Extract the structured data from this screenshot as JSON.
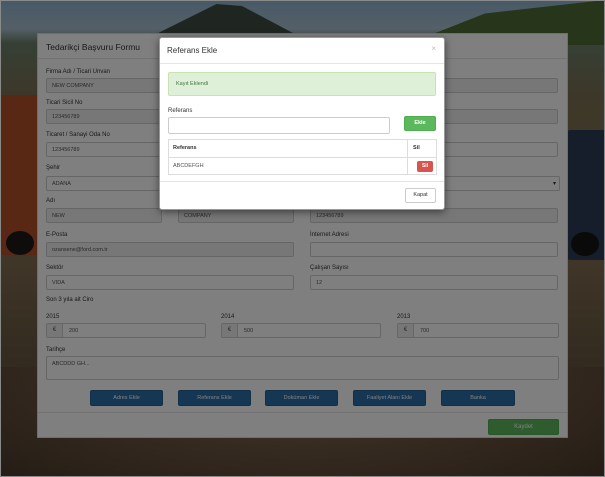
{
  "form": {
    "title": "Tedarikçi Başvuru Formu",
    "firma_adi_label": "Firma Adı / Ticari Unvan",
    "firma_adi_value": "NEW COMPANY",
    "ticari_sicil_label": "Ticari Sicil No",
    "ticari_sicil_value": "123456789",
    "ticaret_odasi_label": "Ticaret / Sanayi Oda No",
    "ticaret_odasi_value": "123456789",
    "sehir_label": "Şehir",
    "sehir_value": "ADANA",
    "adi_label": "Adı",
    "adi_value": "NEW",
    "soyadi_value": "COMPANY",
    "telefon_value": "123456789",
    "eposta_label": "E-Posta",
    "eposta_value": "ozansene@ford.com.tr",
    "internet_label": "İnternet Adresi",
    "internet_value": "",
    "sektor_label": "Sektör",
    "sektor_value": "VIDA",
    "calisan_label": "Çalışan Sayısı",
    "calisan_value": "12",
    "ciro_label": "Son 3 yıla ait Ciro",
    "currency_symbol": "€",
    "ciro": [
      {
        "year": "2015",
        "value": "200"
      },
      {
        "year": "2014",
        "value": "500"
      },
      {
        "year": "2013",
        "value": "700"
      }
    ],
    "tarihce_label": "Tarihçe",
    "tarihce_value": "ABCDDD GH...",
    "buttons": {
      "adres_ekle": "Adres Ekle",
      "referans_ekle": "Referans Ekle",
      "dokuman_ekle": "Doküman Ekle",
      "faaliyet_ekle": "Faaliyet Alanı Ekle",
      "banka": "Banka"
    },
    "kaydet": "Kaydet"
  },
  "modal": {
    "title": "Referans Ekle",
    "close_glyph": "×",
    "alert": "Kayıt Eklendi",
    "referans_label": "Referans",
    "referans_input_value": "",
    "ekle_button": "Ekle",
    "table": {
      "headers": [
        "Referans",
        "Sil"
      ],
      "rows": [
        {
          "referans": "ABCDEFGH",
          "action": "Sil"
        }
      ]
    },
    "kapat_button": "Kapat"
  },
  "colors": {
    "primary": "#2c6fa8",
    "success": "#5cb85c",
    "danger": "#d9534f",
    "alert_bg": "#dff0d8",
    "alert_text": "#3c763d"
  },
  "icons": {
    "close": "close-icon",
    "select_arrow": "chevron-down-icon"
  }
}
